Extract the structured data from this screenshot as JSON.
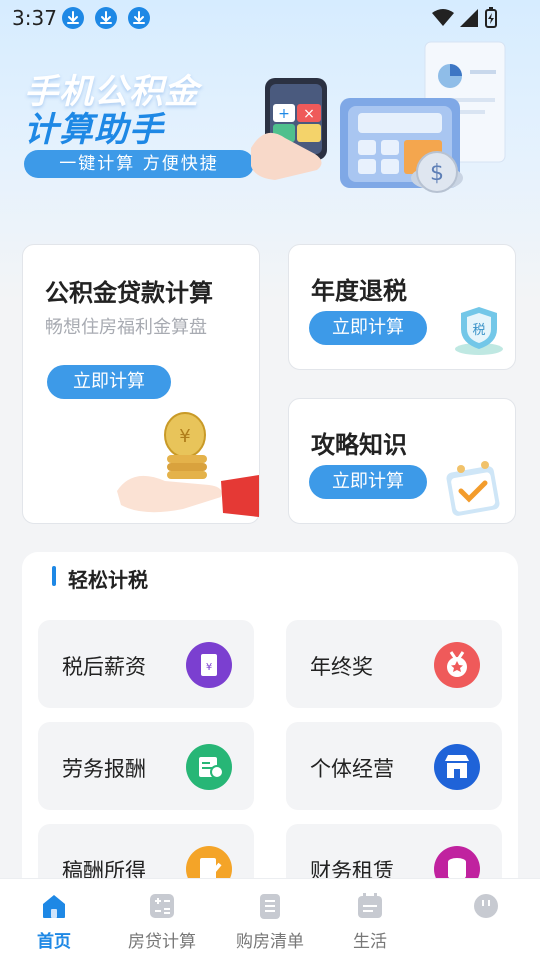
{
  "status_bar": {
    "time": "3:37",
    "notification_icons": [
      "download-icon",
      "download-icon",
      "download-icon"
    ],
    "right_icons": [
      "wifi-icon",
      "signal-icon",
      "battery-icon"
    ]
  },
  "hero": {
    "title_line1": "手机公积金",
    "title_line2": "计算助手",
    "tagline": "一键计算 方便快捷"
  },
  "cards": {
    "loan": {
      "title": "公积金贷款计算",
      "subtitle": "畅想住房福利金算盘",
      "button": "立即计算"
    },
    "tax_refund": {
      "title": "年度退税",
      "button": "立即计算"
    },
    "guide": {
      "title": "攻略知识",
      "button": "立即计算"
    }
  },
  "tax_section": {
    "title": "轻松计税",
    "items": [
      {
        "label": "税后薪资",
        "icon": "payslip-icon",
        "color": "#7b3fd0"
      },
      {
        "label": "年终奖",
        "icon": "medal-icon",
        "color": "#ef5a5a"
      },
      {
        "label": "劳务报酬",
        "icon": "id-card-icon",
        "color": "#27b676"
      },
      {
        "label": "个体经营",
        "icon": "store-icon",
        "color": "#1f63d8"
      },
      {
        "label": "稿酬所得",
        "icon": "edit-document-icon",
        "color": "#f4a428"
      },
      {
        "label": "财务租赁",
        "icon": "coins-icon",
        "color": "#c0229f"
      }
    ]
  },
  "nav": {
    "items": [
      {
        "label": "首页",
        "icon": "home-icon",
        "active": true
      },
      {
        "label": "房贷计算",
        "icon": "calculator-icon",
        "active": false
      },
      {
        "label": "购房清单",
        "icon": "checklist-icon",
        "active": false
      },
      {
        "label": "生活",
        "icon": "calendar-icon",
        "active": false
      },
      {
        "label": "",
        "icon": "profile-icon",
        "active": false
      }
    ]
  },
  "colors": {
    "accent": "#1e88e5",
    "button": "#3d9ae8"
  }
}
